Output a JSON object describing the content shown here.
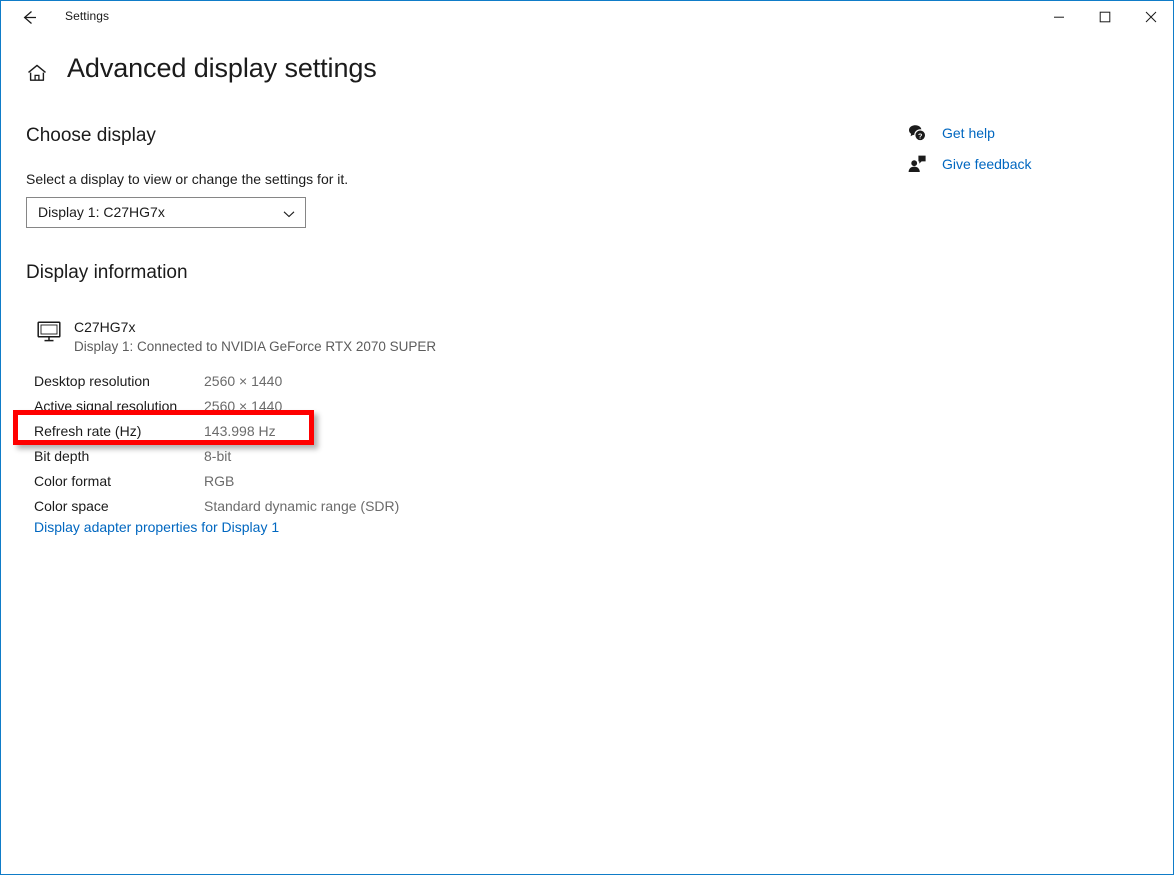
{
  "window": {
    "app_title": "Settings",
    "accent_color": "#0f7cc8",
    "back_icon": "arrow-left-icon",
    "controls": {
      "minimize": "minimize-icon",
      "maximize": "maximize-icon",
      "close": "close-icon"
    }
  },
  "header": {
    "home_icon": "home-icon",
    "title": "Advanced display settings"
  },
  "choose_display": {
    "heading": "Choose display",
    "description": "Select a display to view or change the settings for it.",
    "select": {
      "value": "Display 1: C27HG7x",
      "chevron_icon": "chevron-down-icon",
      "options": [
        "Display 1: C27HG7x"
      ]
    }
  },
  "display_information": {
    "heading": "Display information",
    "monitor_icon": "monitor-icon",
    "monitor_name": "C27HG7x",
    "connection": "Display 1: Connected to NVIDIA GeForce RTX 2070 SUPER",
    "rows": [
      {
        "label": "Desktop resolution",
        "value": "2560 × 1440"
      },
      {
        "label": "Active signal resolution",
        "value": "2560 × 1440"
      },
      {
        "label": "Refresh rate (Hz)",
        "value": "143.998 Hz"
      },
      {
        "label": "Bit depth",
        "value": "8-bit"
      },
      {
        "label": "Color format",
        "value": "RGB"
      },
      {
        "label": "Color space",
        "value": "Standard dynamic range (SDR)"
      }
    ],
    "adapter_link": "Display adapter properties for Display 1"
  },
  "annotation": {
    "target_row_label": "Refresh rate (Hz)",
    "color": "#ff0000"
  },
  "help_rail": {
    "links": [
      {
        "label": "Get help",
        "icon": "help-question-bubble-icon"
      },
      {
        "label": "Give feedback",
        "icon": "feedback-person-icon"
      }
    ],
    "link_color": "#0067c0"
  }
}
